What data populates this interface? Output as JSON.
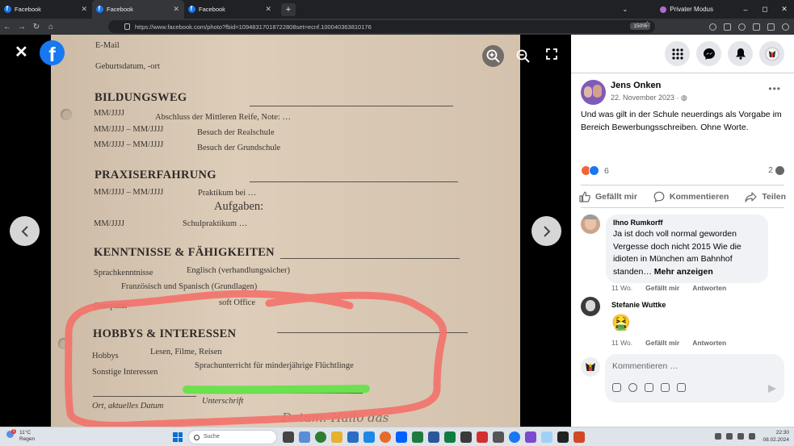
{
  "browser": {
    "tabs": [
      {
        "title": "Facebook"
      },
      {
        "title": "Facebook"
      },
      {
        "title": "Facebook"
      }
    ],
    "new_tab": "+",
    "private_mode": "Privater Modus",
    "url": "https://www.facebook.com/photo?fbid=10948317018722808set=ecnf.100040363810176",
    "zoom": "150%",
    "window_controls": [
      "–",
      "◻",
      "✕"
    ]
  },
  "viewer": {
    "close": "✕",
    "document": {
      "email": "E-Mail",
      "birth": "Geburtsdatum, -ort",
      "sec_bildung": "BILDUNGSWEG",
      "b1_date": "MM/JJJJ",
      "b1_text": "Abschluss der Mittleren Reife, Note: …",
      "b2_date": "MM/JJJJ – MM/JJJJ",
      "b2_text": "Besuch der Realschule",
      "b3_date": "MM/JJJJ – MM/JJJJ",
      "b3_text": "Besuch der Grundschule",
      "sec_praxis": "PRAXISERFAHRUNG",
      "p1_date": "MM/JJJJ – MM/JJJJ",
      "p1_text": "Praktikum bei …",
      "p1_tasks": "Aufgaben:",
      "p2_date": "MM/JJJJ",
      "p2_text": "Schulpraktikum …",
      "sec_kenntnisse": "KENNTNISSE & FÄHIGKEITEN",
      "k1_label": "Sprachkenntnisse",
      "k1_text": "Englisch (verhandlungssicher)",
      "k2_text": "Französisch und Spanisch (Grundlagen)",
      "k3_label": "Computer",
      "k3_text": "soft Office",
      "sec_hobbys": "HOBBYS & INTERESSEN",
      "h1_label": "Hobbys",
      "h1_text": "Lesen, Filme, Reisen",
      "h2_label": "Sonstige Interessen",
      "h2_text": "Sprachunterricht für minderjährige Flüchtlinge",
      "sign_place": "Ort, aktuelles Datum",
      "sign_label": "Unterschrift",
      "handwriting": "Datum: Hallo das"
    }
  },
  "post": {
    "author": "Jens Onken",
    "date": "22. November 2023 · ",
    "text": "Und was gilt in der Schule neuerdings als Vorgabe im Bereich Bewerbungsschreiben. Ohne Worte.",
    "reaction_count": "6",
    "comment_count": "2",
    "actions": {
      "like": "Gefällt mir",
      "comment": "Kommentieren",
      "share": "Teilen"
    },
    "reaction_colors": {
      "angry": "#f0663c",
      "like": "#1877f2"
    }
  },
  "comments": [
    {
      "name": "Ihno Rumkorff",
      "text": "Ja ist doch voll normal geworden Vergesse doch nicht 2015 Wie die idioten in München am Bahnhof standen…",
      "more": "Mehr anzeigen",
      "age": "11 Wo.",
      "like": "Gefällt mir",
      "reply": "Antworten"
    },
    {
      "name": "Stefanie Wuttke",
      "emoji": "🤮",
      "age": "11 Wo.",
      "like": "Gefällt mir",
      "reply": "Antworten"
    }
  ],
  "composer": {
    "placeholder": "Kommentieren …"
  },
  "taskbar": {
    "temp": "11°C",
    "weather": "Regen",
    "notif": "1",
    "search": "Suche",
    "time": "22:30",
    "date": "08.02.2024"
  }
}
